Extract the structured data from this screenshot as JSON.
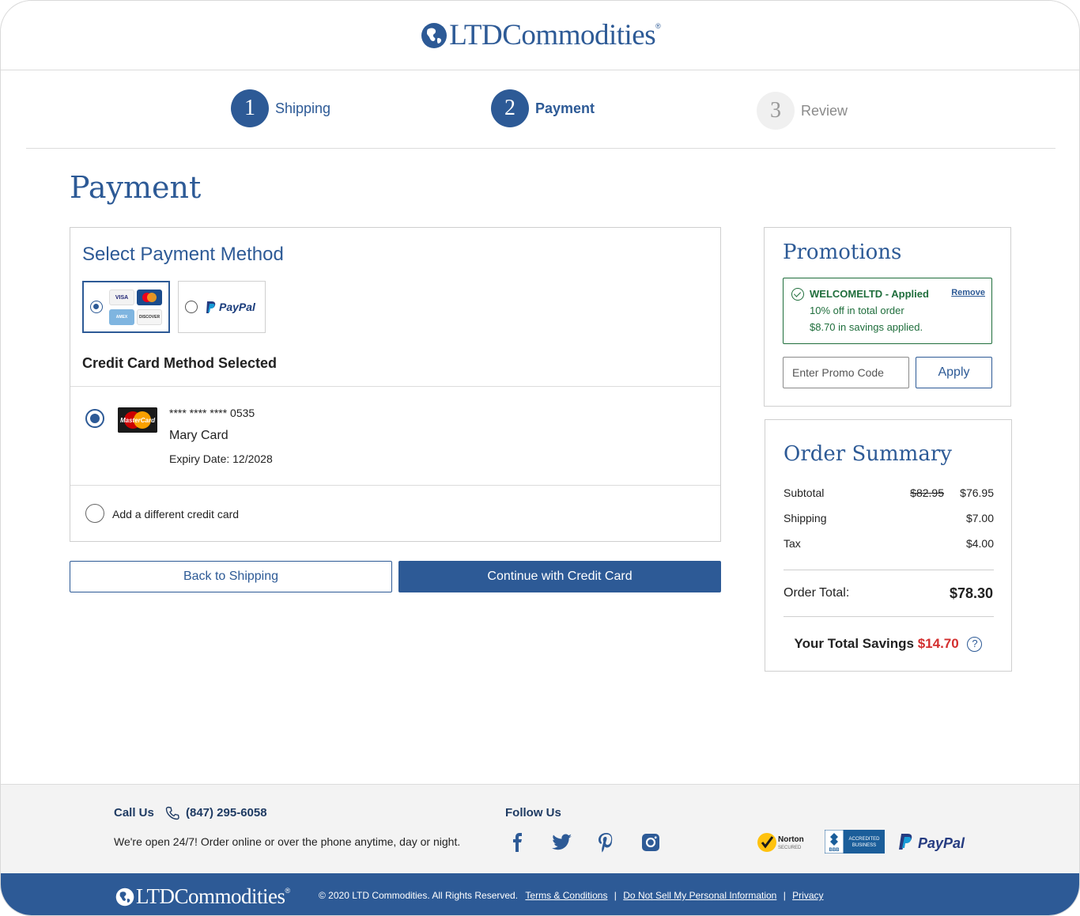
{
  "header": {
    "brand": "LTDCommodities",
    "reg_mark": "®"
  },
  "steps": [
    {
      "num": "1",
      "label": "Shipping",
      "state": "complete"
    },
    {
      "num": "2",
      "label": "Payment",
      "state": "current"
    },
    {
      "num": "3",
      "label": "Review",
      "state": "upcoming"
    }
  ],
  "page_title": "Payment",
  "payment": {
    "heading": "Select Payment Method",
    "methods": [
      {
        "id": "credit-card",
        "selected": true,
        "cards": [
          "VISA",
          "MasterCard",
          "AMEX",
          "DISCOVER"
        ]
      },
      {
        "id": "paypal",
        "selected": false,
        "label": "PayPal"
      }
    ],
    "selected_label": "Credit Card Method Selected",
    "saved_card": {
      "number": "**** **** **** 0535",
      "name": "Mary Card",
      "expiry": "Expiry Date: 12/2028",
      "brand_label": "MasterCard",
      "selected": true
    },
    "add_card_label": "Add a different credit card"
  },
  "buttons": {
    "back": "Back to Shipping",
    "continue": "Continue with Credit Card"
  },
  "promotions": {
    "title": "Promotions",
    "applied_code": "WELCOMELTD - Applied",
    "remove_label": "Remove",
    "line1": "10% off in total order",
    "line2": "$8.70 in savings applied.",
    "input_placeholder": "Enter Promo Code",
    "apply_label": "Apply"
  },
  "summary": {
    "title": "Order Summary",
    "subtotal_label": "Subtotal",
    "subtotal_original": "$82.95",
    "subtotal_value": "$76.95",
    "shipping_label": "Shipping",
    "shipping_value": "$7.00",
    "tax_label": "Tax",
    "tax_value": "$4.00",
    "total_label": "Order Total:",
    "total_value": "$78.30",
    "savings_label": "Your Total Savings",
    "savings_value": "$14.70",
    "help_glyph": "?"
  },
  "footer": {
    "call_us": "Call Us",
    "phone": "(847) 295-6058",
    "hours": "We're open 24/7! Order online or over the phone anytime, day or night.",
    "follow_us": "Follow Us",
    "social": [
      "facebook-icon",
      "twitter-icon",
      "pinterest-icon",
      "instagram-icon"
    ],
    "badges": {
      "norton": "Norton",
      "norton_sub": "SECURED",
      "bbb_line1": "ACCREDITED",
      "bbb_line2": "BUSINESS",
      "bbb": "BBB",
      "paypal": "PayPal"
    },
    "copyright": "© 2020 LTD Commodities. All Rights Reserved.",
    "links": [
      "Terms & Conditions",
      "Do Not Sell My Personal Information",
      "Privacy"
    ],
    "link_separator": "|"
  },
  "colors": {
    "brand_blue": "#2d5a96",
    "success_green": "#1f6e3c",
    "savings_red": "#d32f2f"
  }
}
